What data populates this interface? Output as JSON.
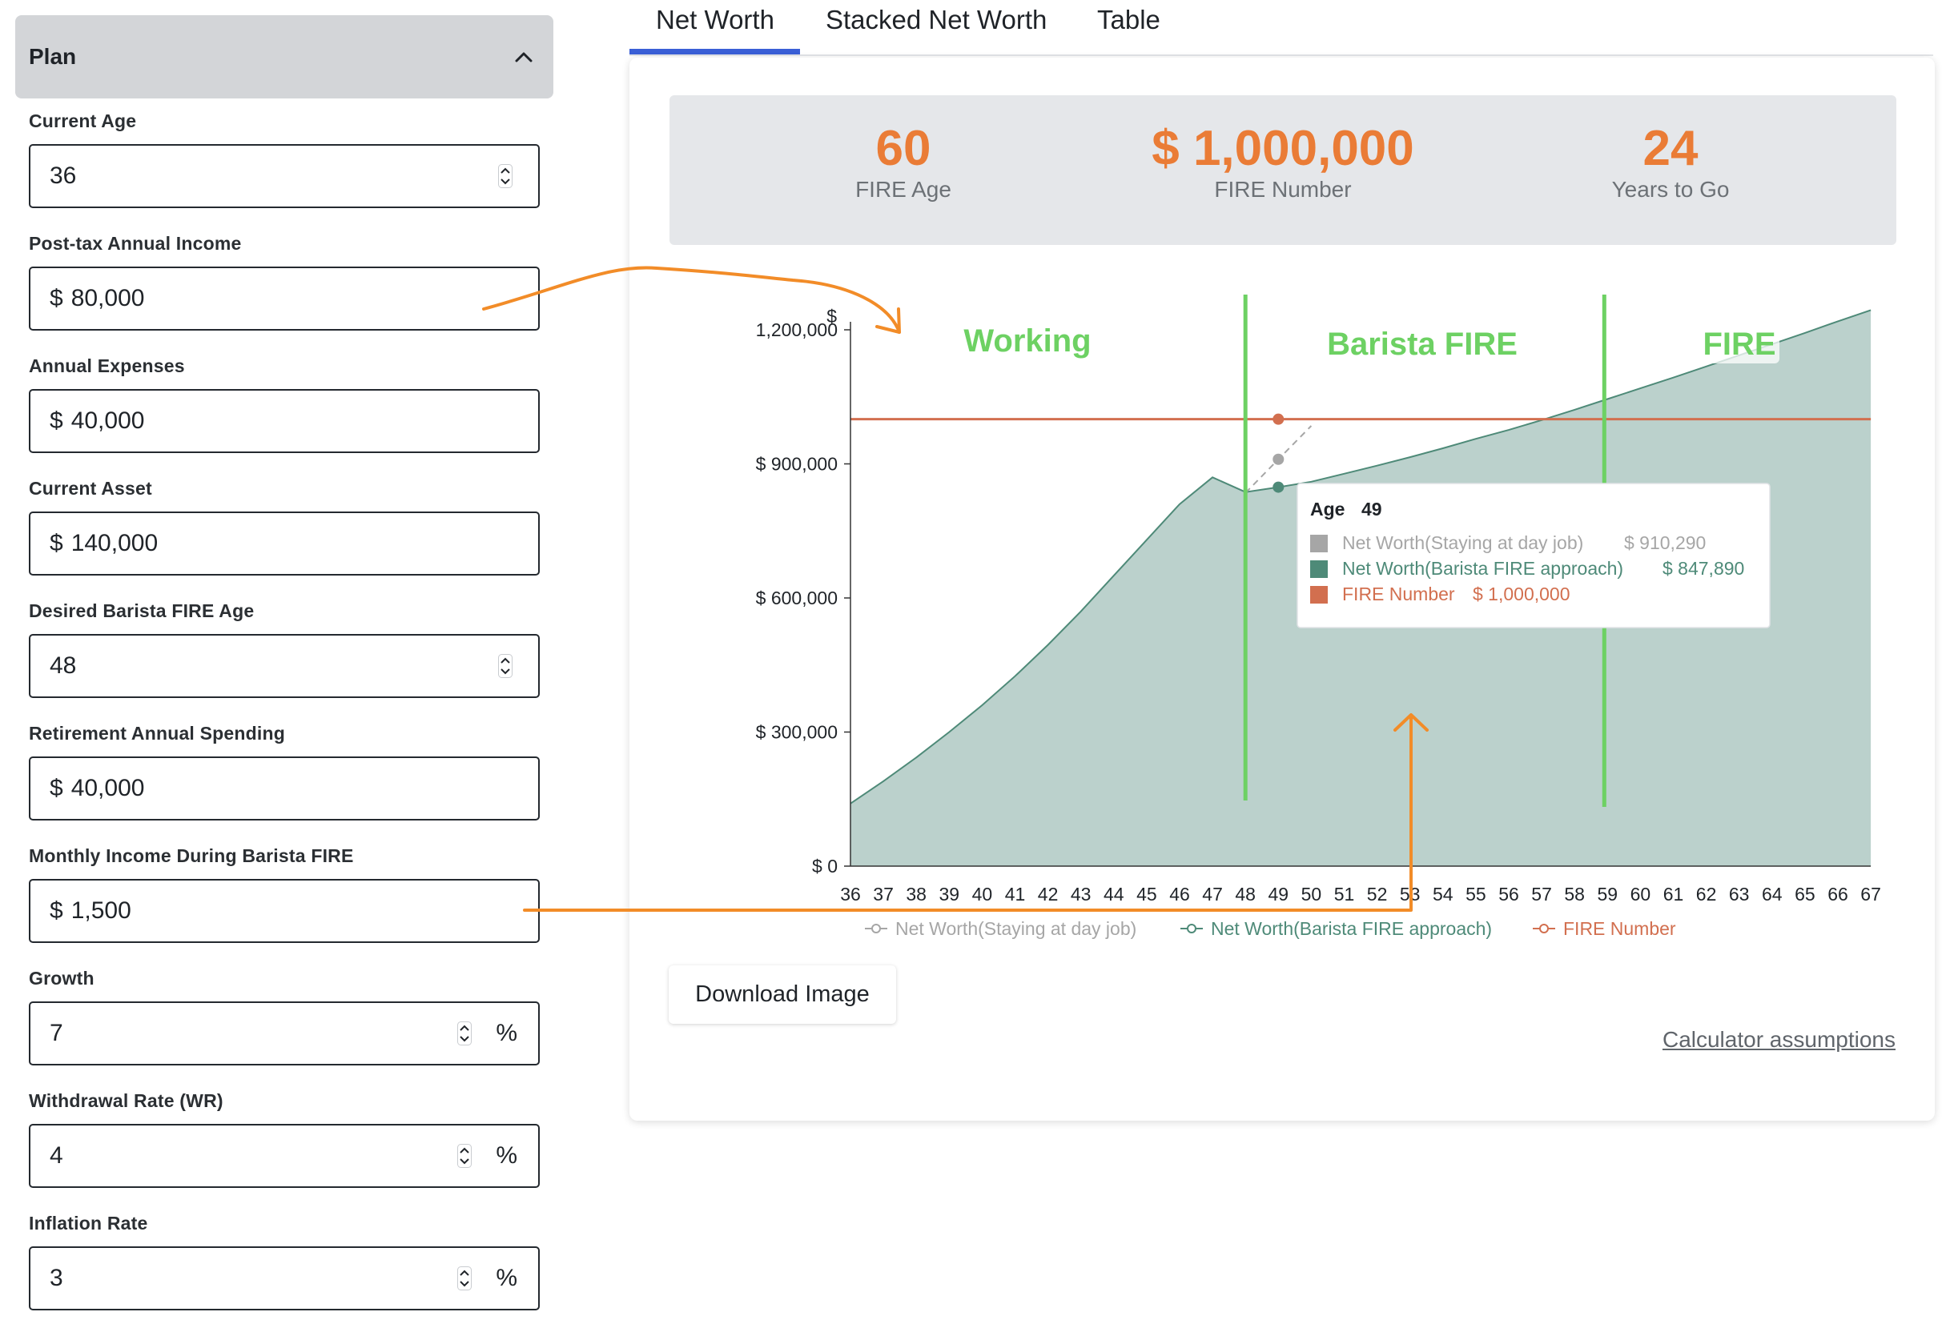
{
  "plan": {
    "title": "Plan",
    "fields": [
      {
        "label": "Current Age",
        "prefix": "",
        "value": "36",
        "spinner": true,
        "suffix": ""
      },
      {
        "label": "Post-tax Annual Income",
        "prefix": "$",
        "value": "80,000",
        "spinner": false,
        "suffix": ""
      },
      {
        "label": "Annual Expenses",
        "prefix": "$",
        "value": "40,000",
        "spinner": false,
        "suffix": ""
      },
      {
        "label": "Current Asset",
        "prefix": "$",
        "value": "140,000",
        "spinner": false,
        "suffix": ""
      },
      {
        "label": "Desired Barista FIRE Age",
        "prefix": "",
        "value": "48",
        "spinner": true,
        "suffix": ""
      },
      {
        "label": "Retirement Annual Spending",
        "prefix": "$",
        "value": "40,000",
        "spinner": false,
        "suffix": ""
      },
      {
        "label": "Monthly Income During Barista FIRE",
        "prefix": "$",
        "value": "1,500",
        "spinner": false,
        "suffix": ""
      },
      {
        "label": "Growth",
        "prefix": "",
        "value": "7",
        "spinner": true,
        "suffix": "%"
      },
      {
        "label": "Withdrawal Rate (WR)",
        "prefix": "",
        "value": "4",
        "spinner": true,
        "suffix": "%"
      },
      {
        "label": "Inflation Rate",
        "prefix": "",
        "value": "3",
        "spinner": true,
        "suffix": "%"
      }
    ]
  },
  "tabs": [
    "Net Worth",
    "Stacked Net Worth",
    "Table"
  ],
  "active_tab": "Net Worth",
  "stats": [
    {
      "value": "60",
      "label": "FIRE Age"
    },
    {
      "value": "$ 1,000,000",
      "label": "FIRE Number"
    },
    {
      "value": "24",
      "label": "Years to Go"
    }
  ],
  "buttons": {
    "download": "Download Image"
  },
  "links": {
    "assumptions": "Calculator assumptions"
  },
  "colors": {
    "accent": "#ea7c36",
    "tab_active": "#3a5fd6",
    "barista_series": "#4e8a78",
    "barista_fill": "#bbd1cc",
    "dayjob_series": "#a6a6a6",
    "fire_number": "#d26f4f",
    "phase_line": "#6dd163",
    "annotation_arrow": "#f28c28"
  },
  "chart_data": {
    "type": "area",
    "x_label_top": "$",
    "y_tick_labels": [
      "1,200,000",
      "$ 900,000",
      "$ 600,000",
      "$ 300,000",
      "$ 0"
    ],
    "y_ticks": [
      1200000,
      900000,
      600000,
      300000,
      0
    ],
    "ylim": [
      0,
      1200000
    ],
    "x": [
      36,
      37,
      38,
      39,
      40,
      41,
      42,
      43,
      44,
      45,
      46,
      47,
      48,
      49,
      50,
      51,
      52,
      53,
      54,
      55,
      56,
      57,
      58,
      59,
      60,
      61,
      62,
      63,
      64,
      65,
      66,
      67
    ],
    "series": [
      {
        "name": "Net Worth(Staying at day job)",
        "values": [
          null,
          null,
          null,
          null,
          null,
          null,
          null,
          null,
          null,
          null,
          null,
          null,
          835000,
          910290,
          985000
        ]
      },
      {
        "name": "Net Worth(Barista FIRE approach)",
        "values": [
          140000,
          190000,
          243000,
          300000,
          360000,
          425000,
          495000,
          570000,
          650000,
          730000,
          810000,
          870000,
          837000,
          847890,
          860000,
          878000,
          896000,
          915000,
          935000,
          956000,
          976000,
          998000,
          1021000,
          1045000,
          1069000,
          1093000,
          1118000,
          1143000,
          1168000,
          1193000,
          1219000,
          1244000
        ]
      },
      {
        "name": "FIRE Number",
        "values": [
          1000000,
          1000000,
          1000000,
          1000000,
          1000000,
          1000000,
          1000000,
          1000000,
          1000000,
          1000000,
          1000000,
          1000000,
          1000000,
          1000000,
          1000000,
          1000000,
          1000000,
          1000000,
          1000000,
          1000000,
          1000000,
          1000000,
          1000000,
          1000000,
          1000000,
          1000000,
          1000000,
          1000000,
          1000000,
          1000000,
          1000000,
          1000000
        ]
      }
    ],
    "phases": [
      {
        "label": "Working"
      },
      {
        "label": "Barista FIRE",
        "start_age": 48
      },
      {
        "label": "FIRE",
        "start_age": 59
      }
    ],
    "tooltip": {
      "title": "Age",
      "age": "49",
      "rows": [
        {
          "name": "Net Worth(Staying at day job)",
          "value": "$ 910,290"
        },
        {
          "name": "Net Worth(Barista FIRE approach)",
          "value": "$ 847,890"
        },
        {
          "name": "FIRE Number",
          "value": "$ 1,000,000"
        }
      ]
    },
    "legend_position": "bottom"
  }
}
